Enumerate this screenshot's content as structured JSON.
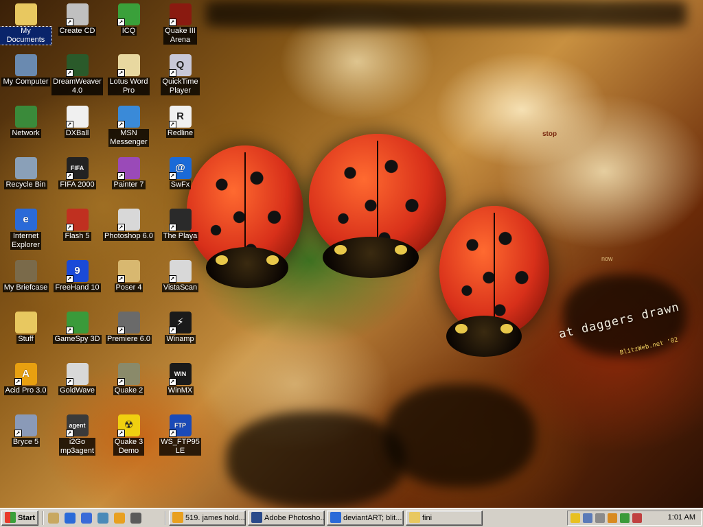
{
  "desktop": {
    "icons": [
      {
        "id": "my-documents",
        "label": "My Documents",
        "icon": "folder-documents-icon",
        "color": "#e8c860",
        "glyph": "",
        "shortcut": false,
        "selected": true
      },
      {
        "id": "my-computer",
        "label": "My Computer",
        "icon": "computer-icon",
        "color": "#6a8ab0",
        "glyph": "",
        "shortcut": false
      },
      {
        "id": "network",
        "label": "Network",
        "icon": "network-icon",
        "color": "#3a8a3a",
        "glyph": "",
        "shortcut": false
      },
      {
        "id": "recycle-bin",
        "label": "Recycle Bin",
        "icon": "recycle-bin-icon",
        "color": "#8aa0b8",
        "glyph": "",
        "shortcut": false
      },
      {
        "id": "internet-explorer",
        "label": "Internet\nExplorer",
        "icon": "internet-explorer-icon",
        "color": "#2a6ad8",
        "glyph": "e",
        "shortcut": false
      },
      {
        "id": "my-briefcase",
        "label": "My Briefcase",
        "icon": "briefcase-icon",
        "color": "#7a6a4a",
        "glyph": "",
        "shortcut": false
      },
      {
        "id": "stuff",
        "label": "Stuff",
        "icon": "folder-icon",
        "color": "#e8c860",
        "glyph": "",
        "shortcut": false
      },
      {
        "id": "acid-pro",
        "label": "Acid Pro 3.0",
        "icon": "acid-pro-icon",
        "color": "#e8a010",
        "glyph": "A",
        "shortcut": true
      },
      {
        "id": "bryce",
        "label": "Bryce 5",
        "icon": "bryce-icon",
        "color": "#8a9ab8",
        "glyph": "",
        "shortcut": true
      },
      {
        "id": "create-cd",
        "label": "Create CD",
        "icon": "cd-icon",
        "color": "#c0c0c0",
        "glyph": "",
        "shortcut": true
      },
      {
        "id": "dreamweaver",
        "label": "DreamWeaver\n4.0",
        "icon": "dreamweaver-icon",
        "color": "#2a5a2a",
        "glyph": "",
        "shortcut": true
      },
      {
        "id": "dxball",
        "label": "DXBall",
        "icon": "dxball-icon",
        "color": "#f0f0f0",
        "glyph": "",
        "shortcut": true
      },
      {
        "id": "fifa",
        "label": "FIFA 2000",
        "icon": "fifa-icon",
        "color": "#222222",
        "glyph": "FIFA",
        "shortcut": true
      },
      {
        "id": "flash",
        "label": "Flash 5",
        "icon": "flash-icon",
        "color": "#c03020",
        "glyph": "",
        "shortcut": true
      },
      {
        "id": "freehand",
        "label": "FreeHand 10",
        "icon": "freehand-icon",
        "color": "#1a4ad8",
        "glyph": "9",
        "shortcut": true
      },
      {
        "id": "gamespy",
        "label": "GameSpy 3D",
        "icon": "gamespy-icon",
        "color": "#3a9a3a",
        "glyph": "",
        "shortcut": true
      },
      {
        "id": "goldwave",
        "label": "GoldWave",
        "icon": "goldwave-icon",
        "color": "#d8d8d8",
        "glyph": "",
        "shortcut": true
      },
      {
        "id": "i2go",
        "label": "i2Go\nmp3agent",
        "icon": "i2go-icon",
        "color": "#3a3a3a",
        "glyph": "agent",
        "shortcut": true
      },
      {
        "id": "icq",
        "label": "ICQ",
        "icon": "icq-flower-icon",
        "color": "#3aa03a",
        "glyph": "",
        "shortcut": true
      },
      {
        "id": "lotus-word-pro",
        "label": "Lotus Word\nPro",
        "icon": "lotus-word-pro-icon",
        "color": "#e8d8a0",
        "glyph": "",
        "shortcut": true
      },
      {
        "id": "msn",
        "label": "MSN\nMessenger",
        "icon": "msn-messenger-icon",
        "color": "#3a8ad8",
        "glyph": "",
        "shortcut": true
      },
      {
        "id": "painter",
        "label": "Painter 7",
        "icon": "painter-icon",
        "color": "#9a4ab8",
        "glyph": "",
        "shortcut": true
      },
      {
        "id": "photoshop",
        "label": "Photoshop 6.0",
        "icon": "photoshop-eye-icon",
        "color": "#d8d8d8",
        "glyph": "",
        "shortcut": true
      },
      {
        "id": "poser",
        "label": "Poser 4",
        "icon": "poser-icon",
        "color": "#d8b870",
        "glyph": "",
        "shortcut": true
      },
      {
        "id": "premiere",
        "label": "Premiere 6.0",
        "icon": "premiere-icon",
        "color": "#6a6a6a",
        "glyph": "",
        "shortcut": true
      },
      {
        "id": "quake2",
        "label": "Quake 2",
        "icon": "quake2-icon",
        "color": "#8a8a6a",
        "glyph": "",
        "shortcut": true
      },
      {
        "id": "quake3demo",
        "label": "Quake 3\nDemo",
        "icon": "radiation-icon",
        "color": "#f0d010",
        "glyph": "☢",
        "shortcut": true
      },
      {
        "id": "quake3arena",
        "label": "Quake III\nArena",
        "icon": "quake3-icon",
        "color": "#8a1a10",
        "glyph": "",
        "shortcut": true
      },
      {
        "id": "quicktime",
        "label": "QuickTime\nPlayer",
        "icon": "quicktime-icon",
        "color": "#c8c8d8",
        "glyph": "Q",
        "shortcut": true
      },
      {
        "id": "redline",
        "label": "Redline",
        "icon": "redline-icon",
        "color": "#f0f0f0",
        "glyph": "R",
        "shortcut": true
      },
      {
        "id": "swfx",
        "label": "SwFx",
        "icon": "swfx-icon",
        "color": "#1a6ad8",
        "glyph": "@",
        "shortcut": true
      },
      {
        "id": "the-playa",
        "label": "The Playa",
        "icon": "playa-icon",
        "color": "#2a2a2a",
        "glyph": "",
        "shortcut": true
      },
      {
        "id": "vistascan",
        "label": "VistaScan",
        "icon": "vistascan-icon",
        "color": "#d8d8d8",
        "glyph": "",
        "shortcut": true
      },
      {
        "id": "winamp",
        "label": "Winamp",
        "icon": "winamp-icon",
        "color": "#1a1a1a",
        "glyph": "⚡",
        "shortcut": true
      },
      {
        "id": "winmx",
        "label": "WinMX",
        "icon": "winmx-icon",
        "color": "#1a1a1a",
        "glyph": "WIN",
        "shortcut": true
      },
      {
        "id": "wsftp",
        "label": "WS_FTP95\nLE",
        "icon": "ws-ftp-icon",
        "color": "#1a4ab8",
        "glyph": "FTP",
        "shortcut": true
      }
    ]
  },
  "wallpaper": {
    "caption": "at daggers drawn",
    "credit": "BlitzWeb.net '02",
    "stop_text": "stop",
    "now_text": "now"
  },
  "taskbar": {
    "start_label": "Start",
    "quick_launch": [
      {
        "icon": "show-desktop-icon",
        "color": "#c8a860"
      },
      {
        "icon": "internet-explorer-icon",
        "color": "#2a6ad8"
      },
      {
        "icon": "outlook-express-icon",
        "color": "#3a6ad8"
      },
      {
        "icon": "quicktime-icon",
        "color": "#4a8ab8"
      },
      {
        "icon": "winamp-icon",
        "color": "#e8a020"
      },
      {
        "icon": "quake-icon",
        "color": "#5a5a5a"
      }
    ],
    "tasks": [
      {
        "label": "519. james hold...",
        "icon": "winamp-icon",
        "color": "#e8a020"
      },
      {
        "label": "Adobe Photosho...",
        "icon": "photoshop-icon",
        "color": "#2a4a8a"
      },
      {
        "label": "deviantART; blit...",
        "icon": "internet-explorer-icon",
        "color": "#2a6ad8"
      },
      {
        "label": "fini",
        "icon": "folder-icon",
        "color": "#e8c860"
      }
    ],
    "tray_icons": [
      {
        "icon": "volume-icon",
        "color": "#e8c020"
      },
      {
        "icon": "network-tray-icon",
        "color": "#5a7ab8"
      },
      {
        "icon": "printer-icon",
        "color": "#8a8a8a"
      },
      {
        "icon": "tool-icon",
        "color": "#d88a20"
      },
      {
        "icon": "msn-tray-icon",
        "color": "#3a9a3a"
      },
      {
        "icon": "scanner-icon",
        "color": "#c04040"
      }
    ],
    "clock": "1:01 AM"
  }
}
